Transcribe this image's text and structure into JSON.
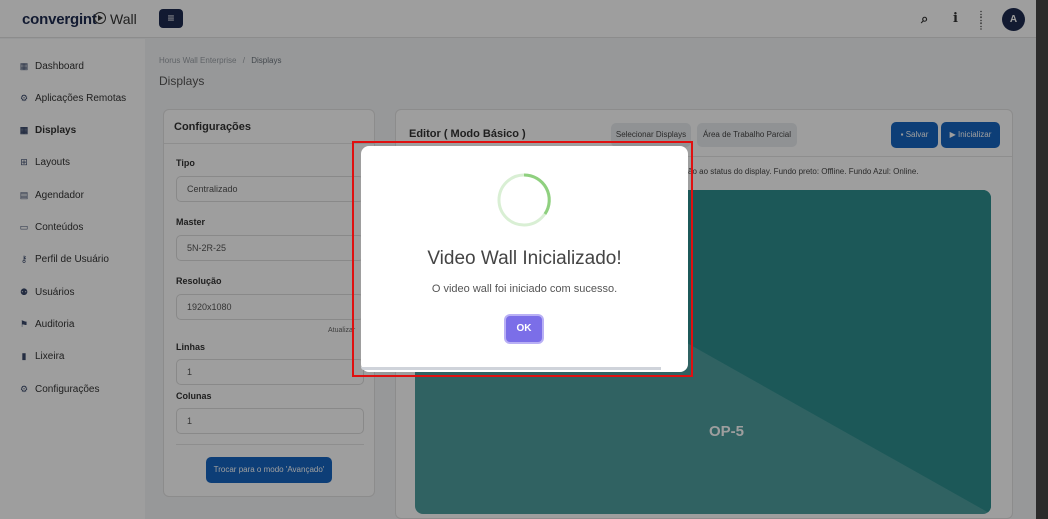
{
  "header": {
    "logo": "convergint",
    "app_name": "Wall",
    "menu_glyph": "≡",
    "search_glyph": "⌕",
    "info_glyph": "i",
    "apps_glyph": "⋮⋮⋮",
    "avatar_initial": "A"
  },
  "sidebar": {
    "items": [
      {
        "label": "Dashboard",
        "icon": "▦"
      },
      {
        "label": "Aplicações Remotas",
        "icon": "⚙"
      },
      {
        "label": "Displays",
        "icon": "▦"
      },
      {
        "label": "Layouts",
        "icon": "⊞"
      },
      {
        "label": "Agendador",
        "icon": "▤"
      },
      {
        "label": "Conteúdos",
        "icon": "▭"
      },
      {
        "label": "Perfil de Usuário",
        "icon": "⚷"
      },
      {
        "label": "Usuários",
        "icon": "⚉"
      },
      {
        "label": "Auditoria",
        "icon": "⚑"
      },
      {
        "label": "Lixeira",
        "icon": "▮"
      },
      {
        "label": "Configurações",
        "icon": "⚙"
      }
    ]
  },
  "breadcrumb": {
    "root": "Horus Wall Enterprise",
    "separator": "/",
    "current": "Displays"
  },
  "page_title": "Displays",
  "config": {
    "title": "Configurações",
    "tipo_label": "Tipo",
    "tipo_value": "Centralizado",
    "master_label": "Master",
    "master_value": "5N-2R-25",
    "resolucao_label": "Resolução",
    "resolucao_value": "1920x1080",
    "atualizar": "Atualizar",
    "linhas_label": "Linhas",
    "linhas_value": "1",
    "colunas_label": "Colunas",
    "colunas_value": "1",
    "switch_button": "Trocar para o modo 'Avançado'"
  },
  "editor": {
    "title": "Editor  ( Modo Básico )",
    "select_displays": "Selecionar Displays",
    "partial_area": "Área de Trabalho Parcial",
    "save": "Salvar",
    "start": "Inicializar",
    "hint": "ão ao status do display. Fundo preto: Offline. Fundo Azul: Online.",
    "display_label": "OP-5",
    "colors": {
      "teal_dark": "#2e8f8f",
      "teal_light": "#4e9e9f"
    }
  },
  "modal": {
    "title": "Video Wall Inicializado!",
    "text": "O video wall foi iniciado com sucesso.",
    "ok": "OK"
  }
}
